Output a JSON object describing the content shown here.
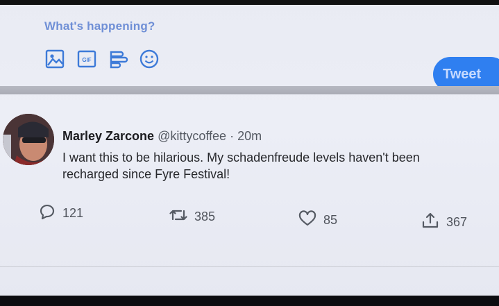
{
  "composer": {
    "placeholder": "What's happening?",
    "tools": [
      {
        "icon": "image-icon"
      },
      {
        "icon": "gif-icon",
        "label": "GIF"
      },
      {
        "icon": "poll-icon"
      },
      {
        "icon": "emoji-icon"
      }
    ],
    "tweet_button": "Tweet"
  },
  "tweet": {
    "author_name": "Marley Zarcone",
    "handle": "@kittycoffee",
    "separator": "·",
    "time": "20m",
    "text": "I want this to be hilarious. My schadenfreude levels haven't been recharged since Fyre Festival!",
    "actions": {
      "reply": {
        "icon": "reply-icon",
        "count": "121"
      },
      "retweet": {
        "icon": "retweet-icon",
        "count": "385"
      },
      "like": {
        "icon": "heart-icon",
        "count": "85"
      },
      "share": {
        "icon": "share-icon",
        "count": "367"
      }
    }
  },
  "colors": {
    "accent": "#2f7ff0",
    "icon_blue": "#3d7ad8",
    "background": "#e9ebf3",
    "text": "#26272b"
  }
}
